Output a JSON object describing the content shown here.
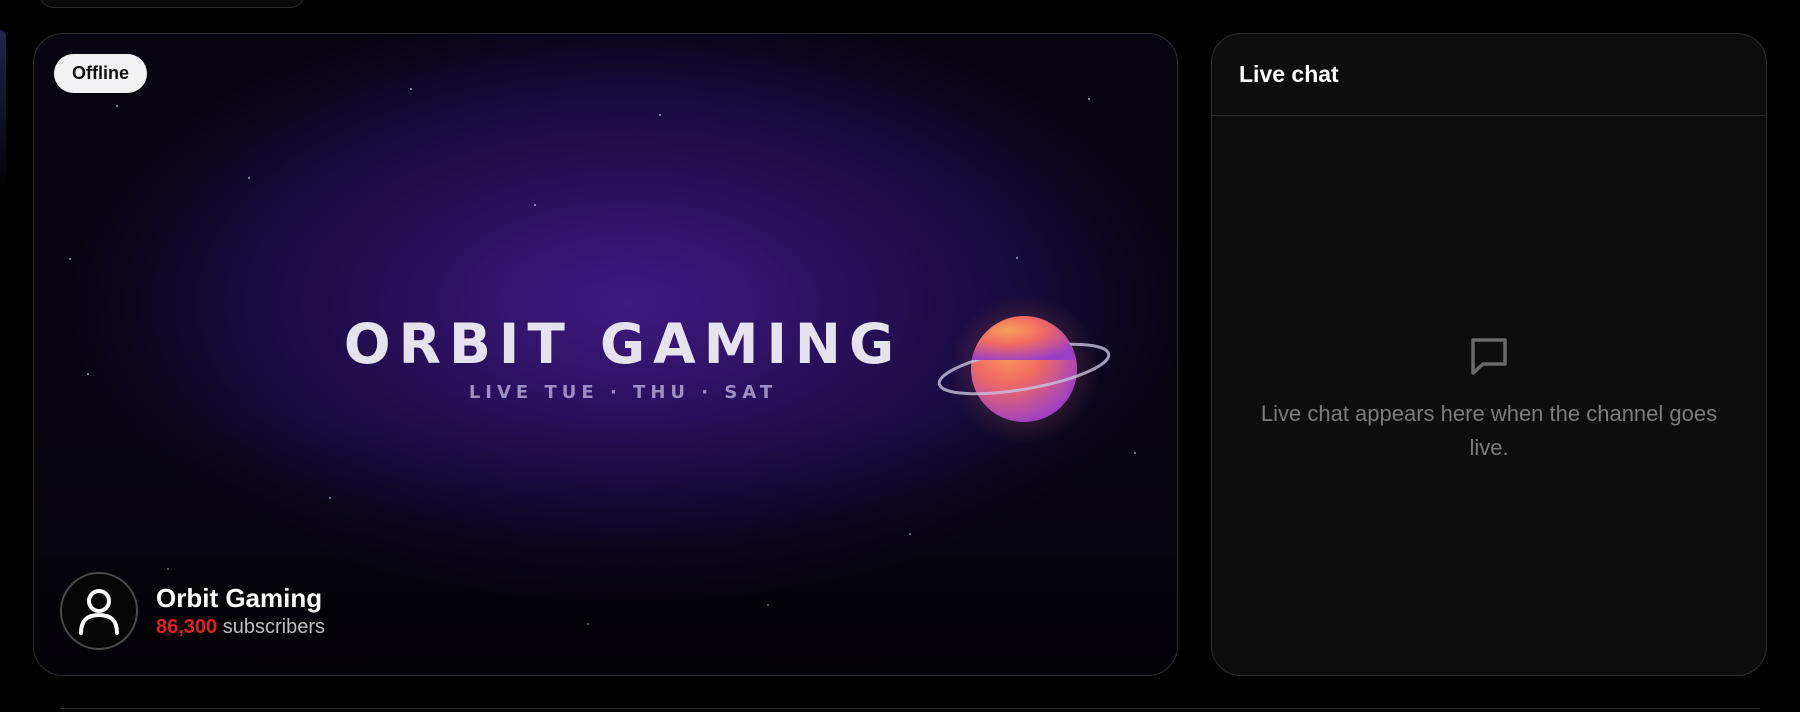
{
  "banner": {
    "status_badge": "Offline",
    "title": "ORBIT GAMING",
    "schedule": "LIVE TUE · THU · SAT",
    "colors": {
      "sky_center": "#3e1b80",
      "planet": "#f2784b",
      "ring": "#c8c2e0"
    }
  },
  "channel": {
    "name": "Orbit Gaming",
    "subscriber_count": "86,300",
    "subscriber_label": "subscribers",
    "avatar_icon": "user-icon",
    "count_color": "#e02020"
  },
  "chat": {
    "title": "Live chat",
    "empty_icon": "chat-bubble-icon",
    "empty_message": "Live chat appears here when the channel goes live."
  }
}
